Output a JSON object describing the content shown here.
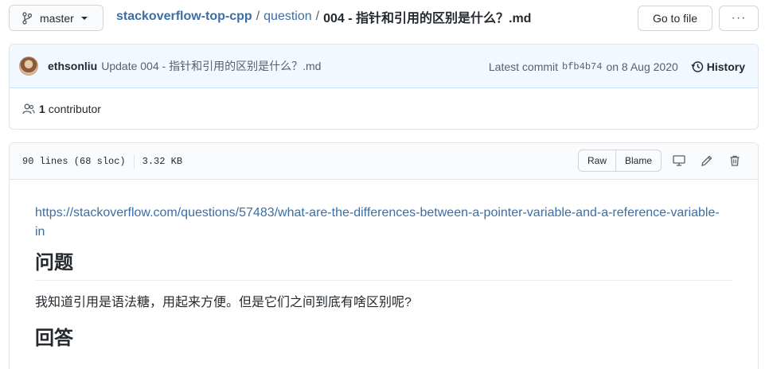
{
  "branch": {
    "name": "master"
  },
  "breadcrumb": {
    "repo": "stackoverflow-top-cpp",
    "sep1": "/",
    "dir": "question",
    "sep2": "/",
    "file": "004 - 指针和引用的区别是什么？.md"
  },
  "actions": {
    "goto_file": "Go to file",
    "more": "···"
  },
  "commit": {
    "author": "ethsonliu",
    "message": "Update 004 - 指针和引用的区别是什么？.md",
    "latest_label": "Latest commit",
    "sha": "bfb4b74",
    "date": "on 8 Aug 2020",
    "history_label": "History"
  },
  "contributors": {
    "count": "1",
    "label": "contributor"
  },
  "file_info": {
    "lines": "90 lines (68 sloc)",
    "size": "3.32 KB"
  },
  "file_buttons": {
    "raw": "Raw",
    "blame": "Blame"
  },
  "icons": [
    "branch-icon",
    "history-icon",
    "people-icon",
    "desktop-icon",
    "pencil-icon",
    "trash-icon"
  ],
  "content": {
    "link": "https://stackoverflow.com/questions/57483/what-are-the-differences-between-a-pointer-variable-and-a-reference-variable-in",
    "heading1": "问题",
    "paragraph1": "我知道引用是语法糖，用起来方便。但是它们之间到底有啥区别呢?",
    "heading2": "回答"
  }
}
